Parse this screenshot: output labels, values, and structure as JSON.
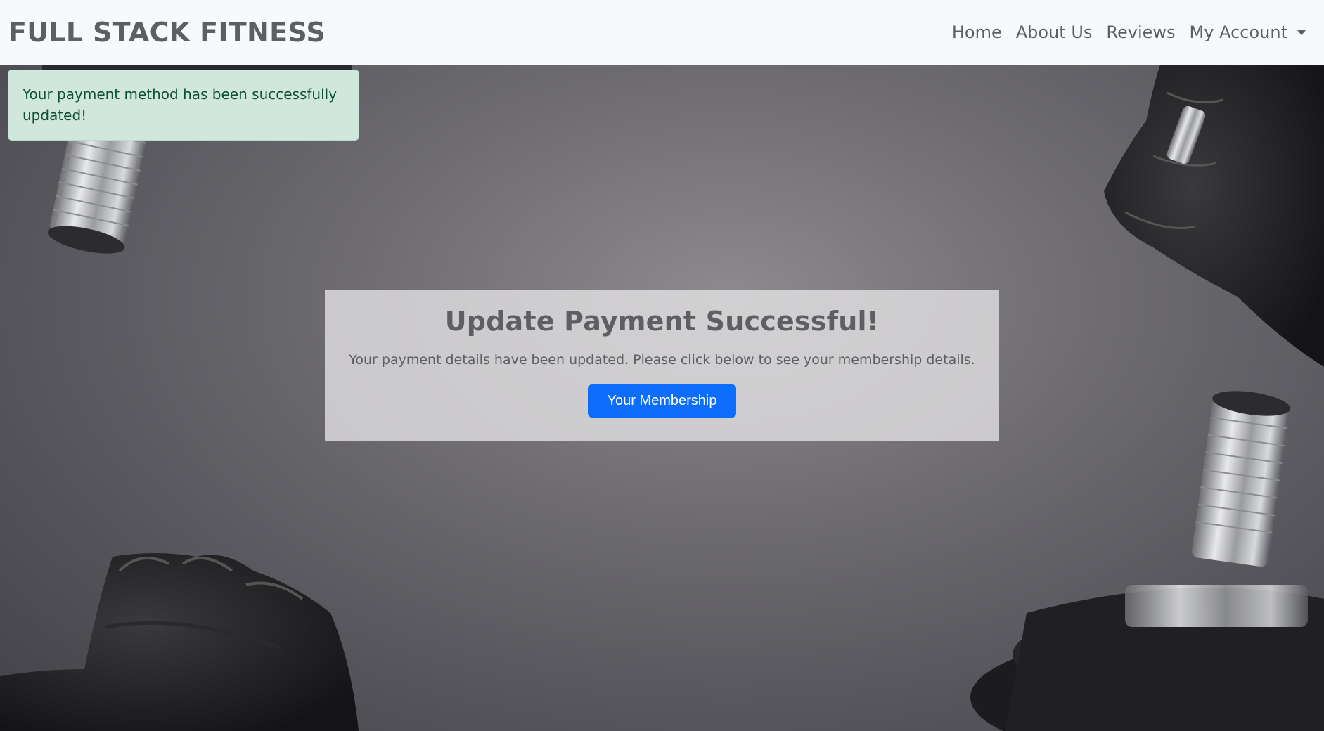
{
  "navbar": {
    "brand": "FULL STACK FITNESS",
    "links": [
      "Home",
      "About Us",
      "Reviews"
    ],
    "account_label": "My Account"
  },
  "alert": {
    "message": "Your payment method has been successfully updated!"
  },
  "panel": {
    "title": "Update Payment Successful!",
    "text": "Your payment details have been updated. Please click below to see your membership details.",
    "button_label": "Your Membership"
  },
  "colors": {
    "navbar_bg": "#f8f9fa",
    "primary": "#0d6efd",
    "alert_bg": "#d1e7dd",
    "alert_text": "#0f5132",
    "text_muted": "#5d5f63"
  }
}
